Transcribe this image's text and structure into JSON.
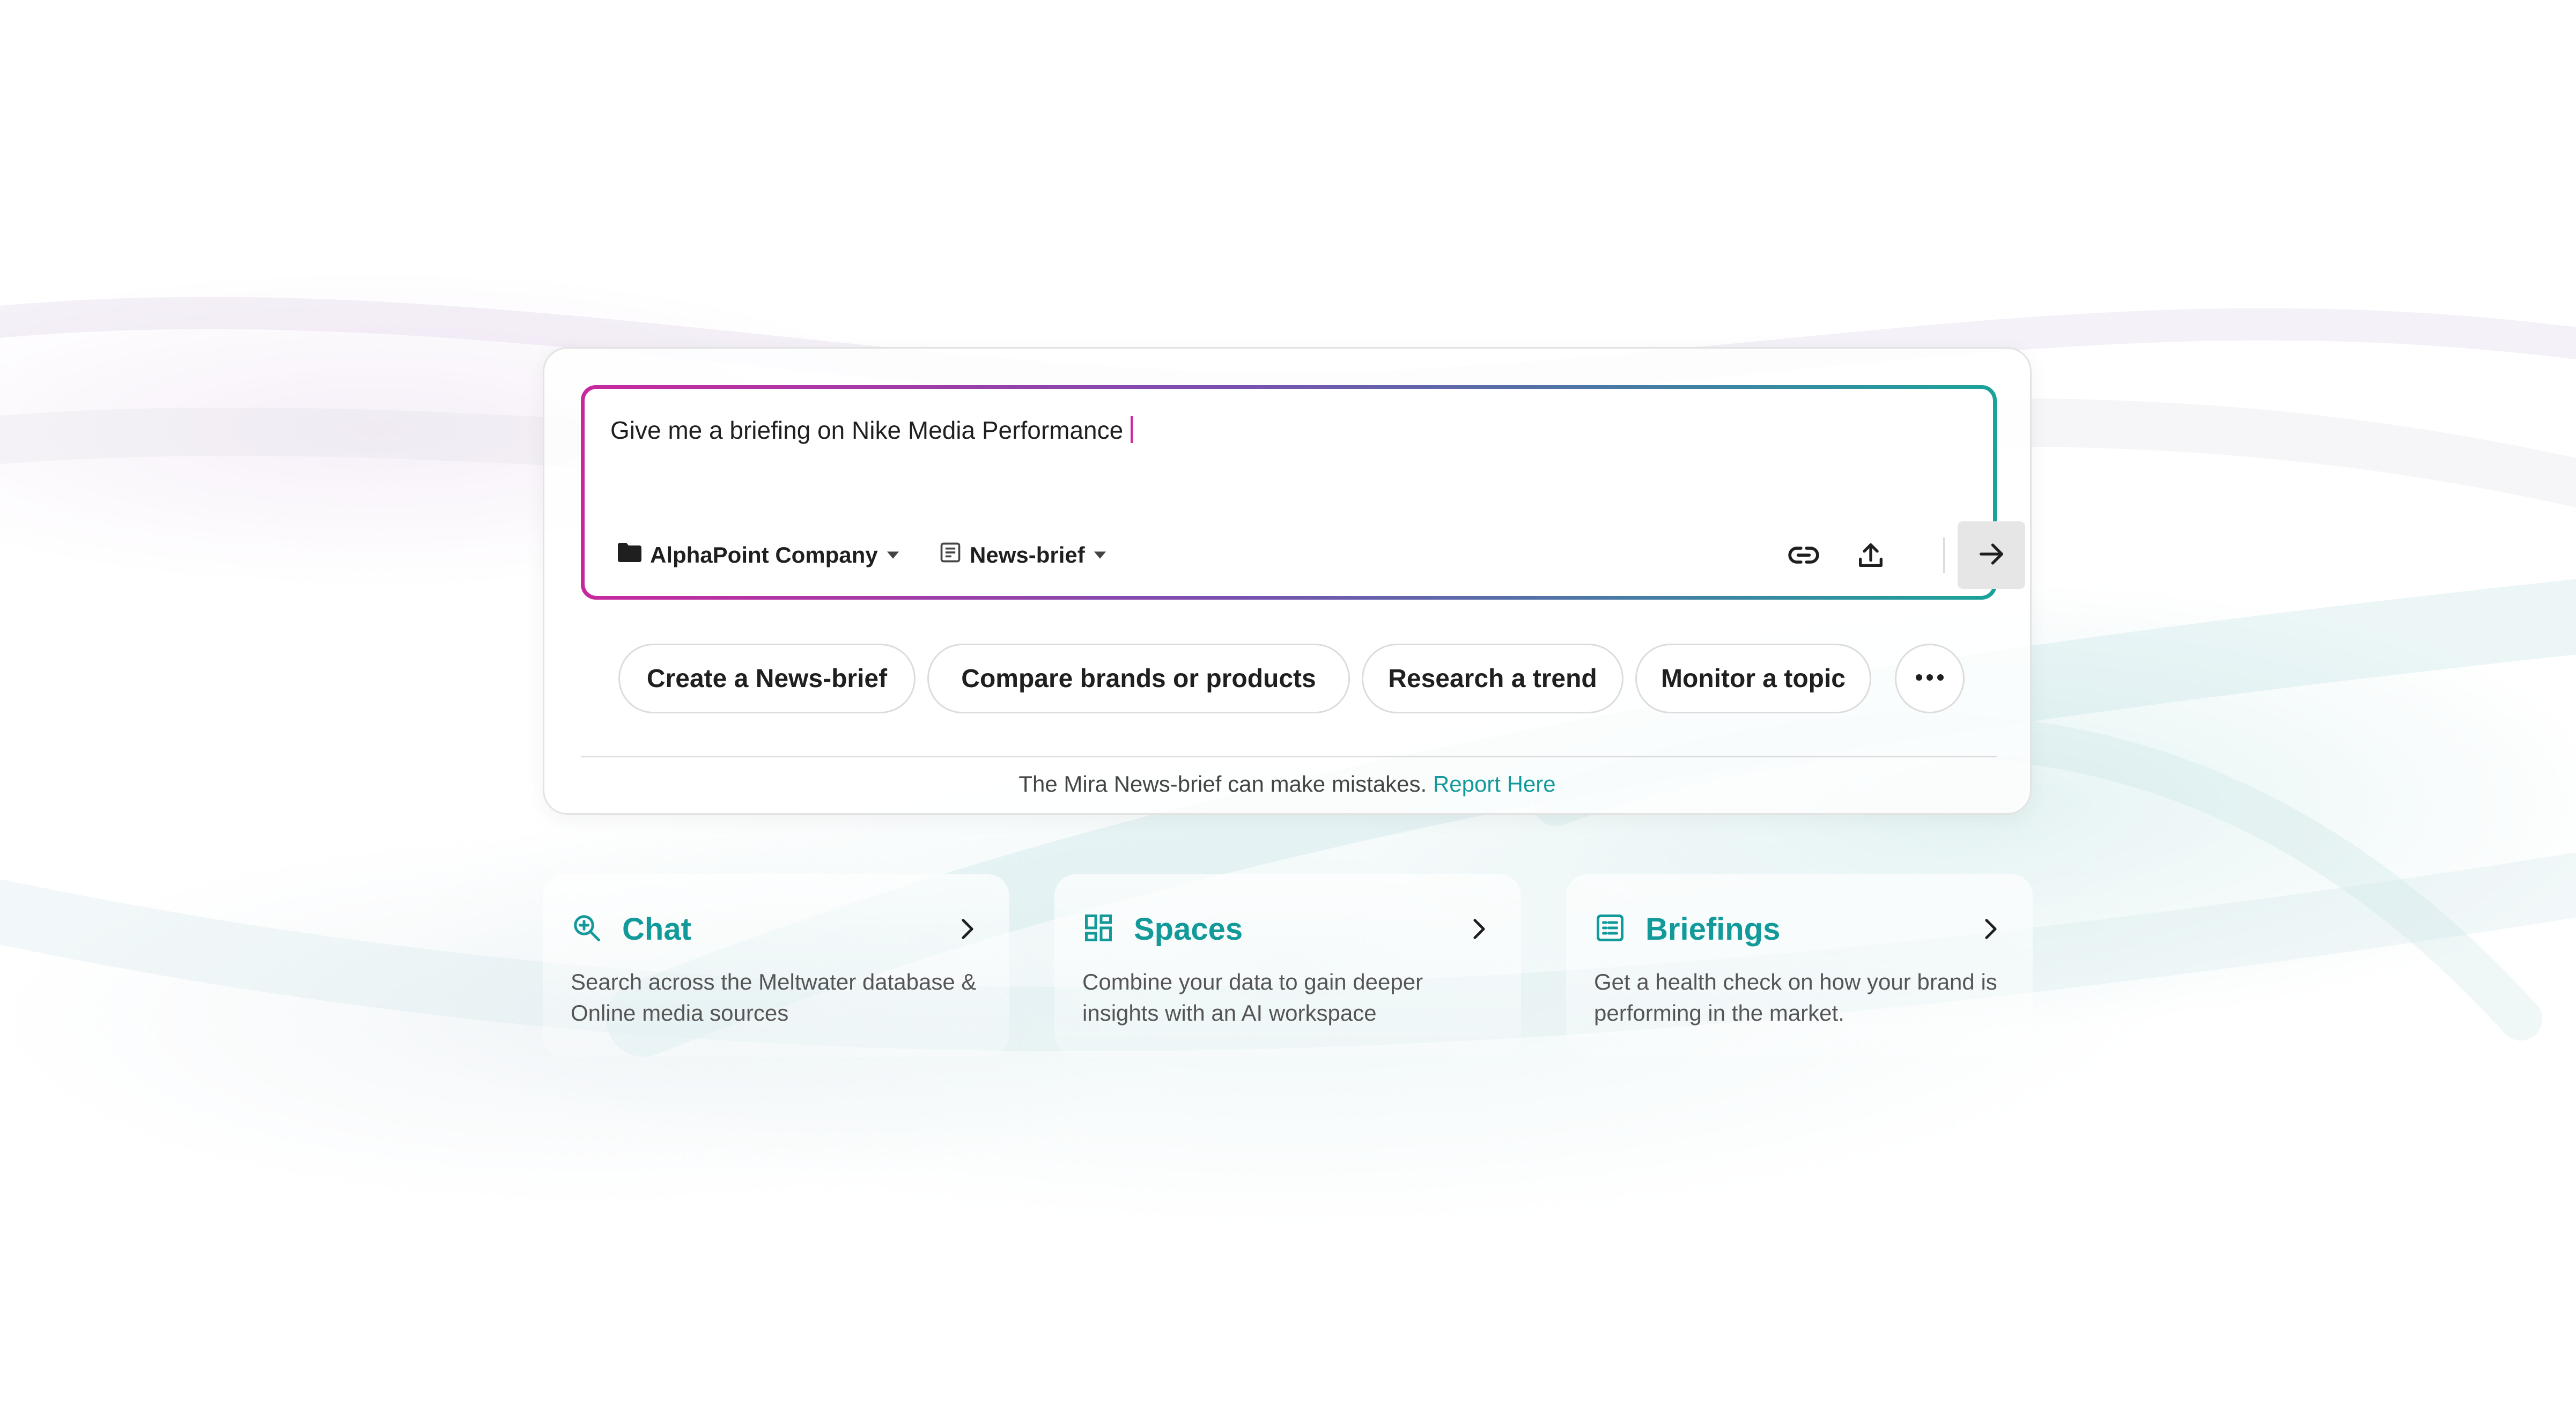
{
  "prompt": {
    "text": "Give me a briefing on Nike Media Performance",
    "company_selector": "AlphaPoint Company",
    "type_selector": "News-brief"
  },
  "suggestions": [
    {
      "label": "Create a News-brief"
    },
    {
      "label": "Compare brands or products"
    },
    {
      "label": "Research a trend"
    },
    {
      "label": "Monitor a topic"
    }
  ],
  "disclaimer": {
    "text": "The Mira News-brief can make mistakes.",
    "link": "Report Here"
  },
  "features": [
    {
      "title": "Chat",
      "icon": "search-icon",
      "description": "Search across the Meltwater database & Online media sources"
    },
    {
      "title": "Spaces",
      "icon": "dashboard-icon",
      "description": "Combine your data to gain deeper insights with an AI workspace"
    },
    {
      "title": "Briefings",
      "icon": "document-icon",
      "description": "Get a health check on how your brand is performing in the market."
    }
  ],
  "colors": {
    "accent_teal": "#12999a",
    "accent_magenta": "#c8289e",
    "border_gray": "#dcdcdc"
  }
}
